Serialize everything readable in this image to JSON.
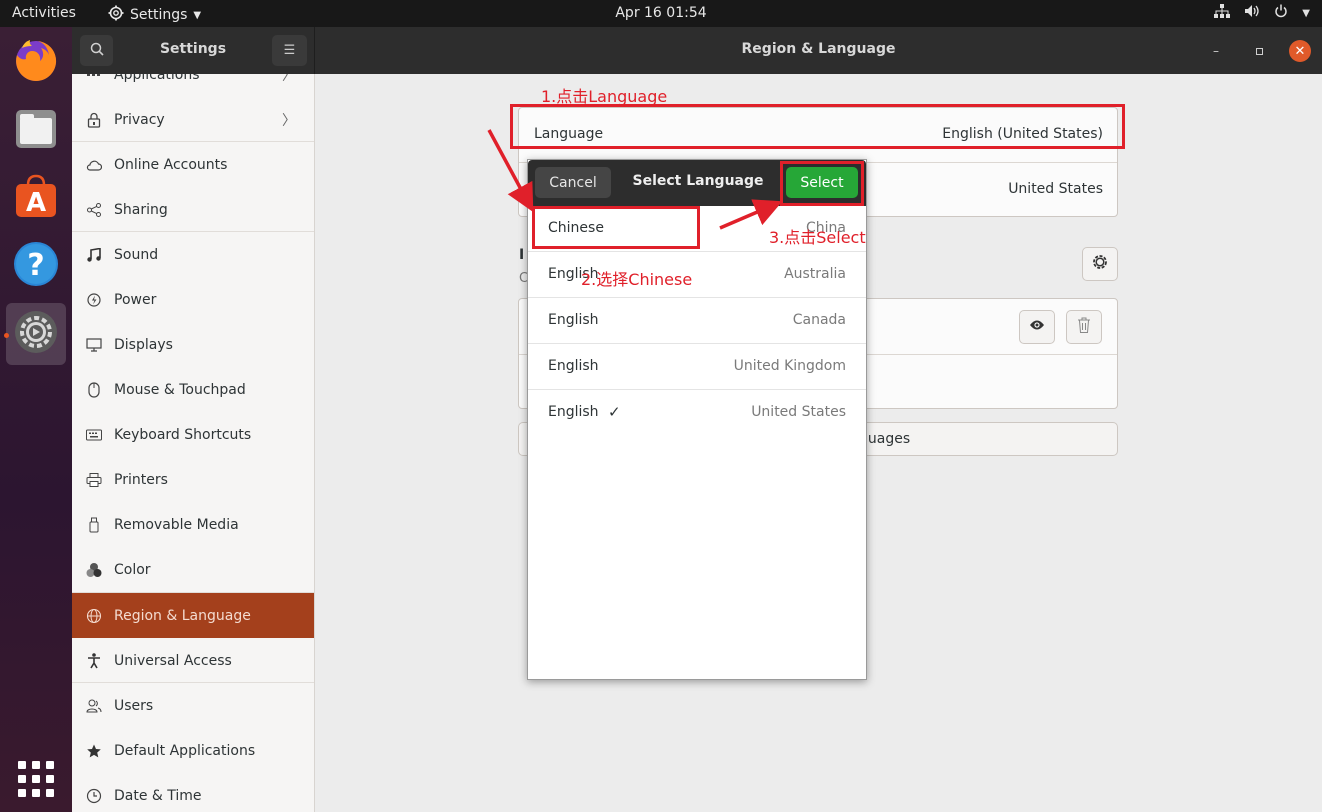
{
  "topbar": {
    "activities": "Activities",
    "app_name": "Settings",
    "clock": "Apr 16  01:54",
    "tray_icons": [
      "network-icon",
      "volume-icon",
      "power-icon",
      "chevron-down-icon"
    ]
  },
  "dock": {
    "apps": [
      "firefox",
      "files",
      "ubuntu-software",
      "help",
      "settings"
    ],
    "active_app": "settings"
  },
  "header": {
    "sidebar_title": "Settings",
    "page_title": "Region & Language",
    "close_color": "#e05a2a"
  },
  "sidebar": {
    "items": [
      {
        "label": "Applications",
        "icon": "apps-icon",
        "chevron": true
      },
      {
        "label": "Privacy",
        "icon": "lock-icon",
        "chevron": true
      },
      {
        "label": "Online Accounts",
        "icon": "cloud-icon"
      },
      {
        "label": "Sharing",
        "icon": "share-icon"
      },
      {
        "label": "Sound",
        "icon": "music-note-icon"
      },
      {
        "label": "Power",
        "icon": "power-icon"
      },
      {
        "label": "Displays",
        "icon": "display-icon"
      },
      {
        "label": "Mouse & Touchpad",
        "icon": "mouse-icon"
      },
      {
        "label": "Keyboard Shortcuts",
        "icon": "keyboard-icon"
      },
      {
        "label": "Printers",
        "icon": "printer-icon"
      },
      {
        "label": "Removable Media",
        "icon": "usb-icon"
      },
      {
        "label": "Color",
        "icon": "color-icon"
      },
      {
        "label": "Region & Language",
        "icon": "globe-icon",
        "selected": true
      },
      {
        "label": "Universal Access",
        "icon": "accessibility-icon"
      },
      {
        "label": "Users",
        "icon": "users-icon"
      },
      {
        "label": "Default Applications",
        "icon": "star-icon"
      },
      {
        "label": "Date & Time",
        "icon": "clock-icon"
      }
    ],
    "selected_color": "#a4401c"
  },
  "main": {
    "language_label": "Language",
    "language_value": "English (United States)",
    "formats_value": "United States",
    "input_heading_partial": "I",
    "input_subtitle_partial": "C",
    "manage_languages_partial": "guages"
  },
  "dialog": {
    "cancel_label": "Cancel",
    "title": "Select Language",
    "select_label": "Select",
    "select_color": "#26a737",
    "rows": [
      {
        "name": "Chinese",
        "region": "China"
      },
      {
        "name": "English",
        "region": "Australia"
      },
      {
        "name": "English",
        "region": "Canada"
      },
      {
        "name": "English",
        "region": "United Kingdom"
      },
      {
        "name": "English",
        "region": "United States",
        "checked": true
      }
    ]
  },
  "annotations": {
    "color": "#e0202a",
    "step1": "1.点击Language",
    "step2": "2.选择Chinese",
    "step3": "3.点击Select"
  }
}
